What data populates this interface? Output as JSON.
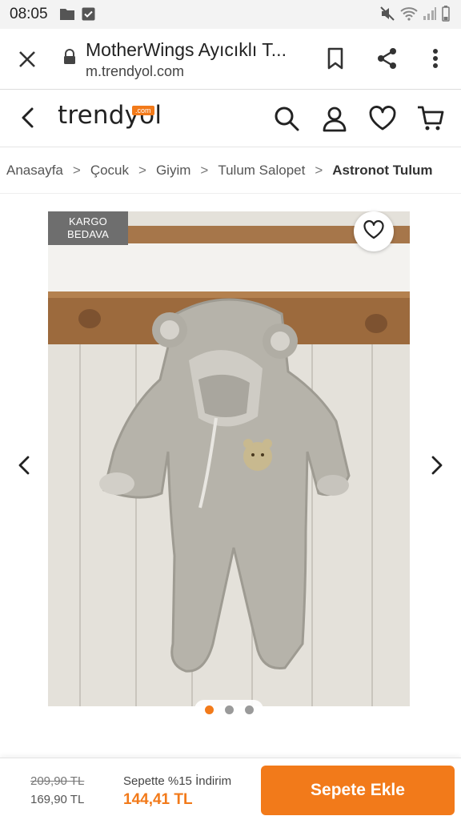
{
  "status_bar": {
    "time": "08:05"
  },
  "browser": {
    "page_title": "MotherWings Ayıcıklı T...",
    "url": "m.trendyol.com"
  },
  "header": {
    "brand_word": "trendyol",
    "brand_badge": ".com"
  },
  "breadcrumb": {
    "items": [
      "Anasayfa",
      "Çocuk",
      "Giyim",
      "Tulum Salopet",
      "Astronot Tulum"
    ],
    "separator": ">"
  },
  "product": {
    "badge_line1": "KARGO",
    "badge_line2": "BEDAVA",
    "image_count": 3,
    "active_image_index": 0
  },
  "bottom_bar": {
    "original_price": "209,90 TL",
    "list_price": "169,90 TL",
    "promo_text": "Sepette %15 İndirim",
    "final_price": "144,41 TL",
    "add_to_cart_label": "Sepete Ekle"
  },
  "colors": {
    "accent": "#f27a1a",
    "badge_bg": "#6e6e6e",
    "text_primary": "#222222"
  },
  "icons": [
    "folder-icon",
    "check-square-icon",
    "mute-icon",
    "wifi-icon",
    "signal-icon",
    "close-icon",
    "lock-icon",
    "bookmark-icon",
    "share-icon",
    "more-vert-icon",
    "back-icon",
    "search-icon",
    "user-icon",
    "heart-icon",
    "cart-icon",
    "chevron-left-icon",
    "chevron-right-icon"
  ]
}
